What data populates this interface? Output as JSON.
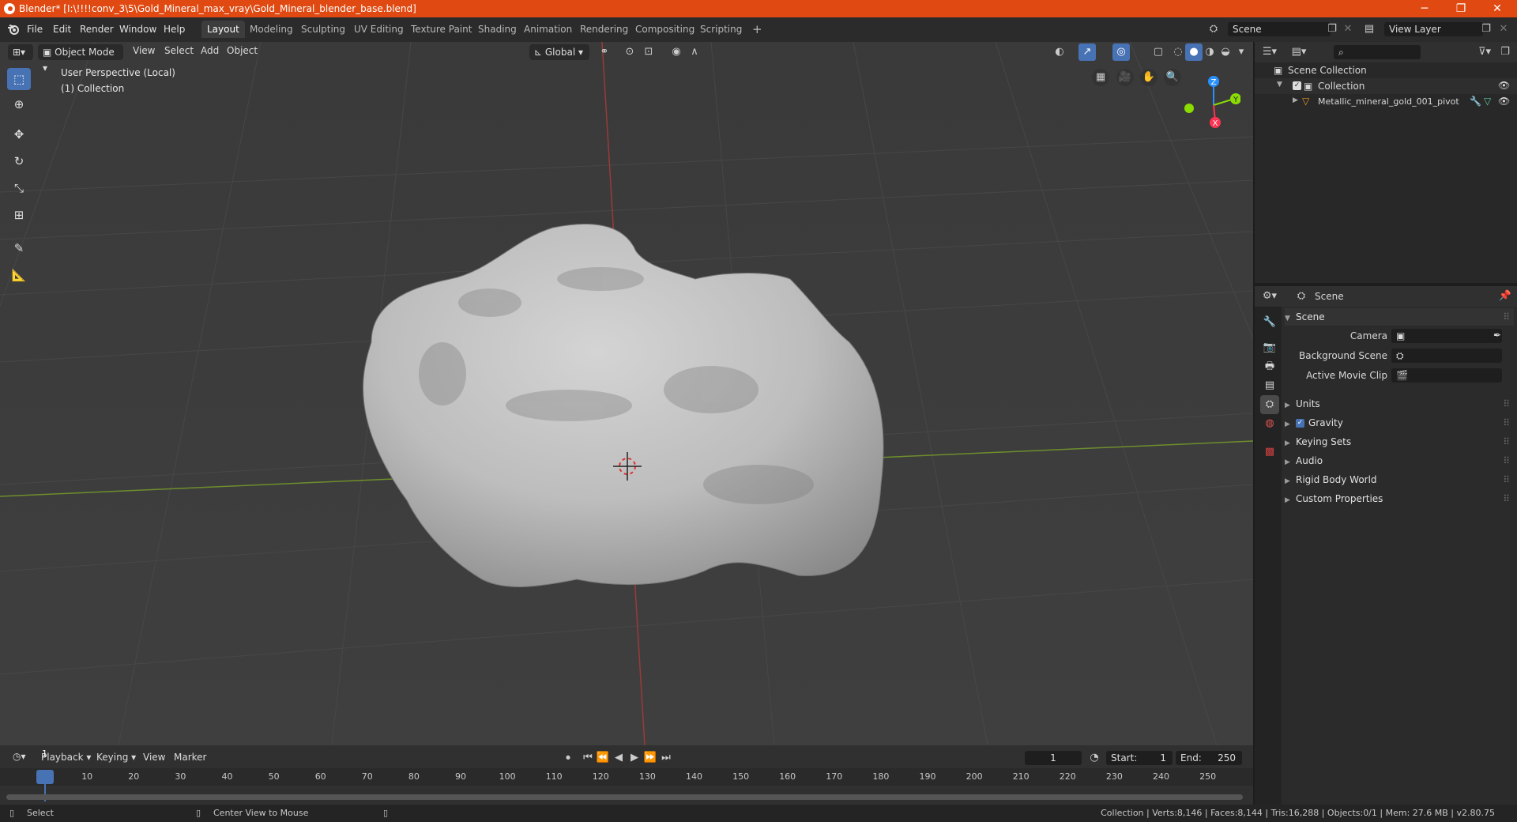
{
  "window": {
    "title": "Blender* [I:\\!!!!conv_3\\5\\Gold_Mineral_max_vray\\Gold_Mineral_blender_base.blend]",
    "minimize": "─",
    "maximize": "❐",
    "close": "✕"
  },
  "menu": [
    "File",
    "Edit",
    "Render",
    "Window",
    "Help"
  ],
  "workspaces": [
    "Layout",
    "Modeling",
    "Sculpting",
    "UV Editing",
    "Texture Paint",
    "Shading",
    "Animation",
    "Rendering",
    "Compositing",
    "Scripting"
  ],
  "add_workspace": "+",
  "scene_field": "Scene",
  "view_layer_field": "View Layer",
  "viewport": {
    "mode": "Object Mode",
    "menus": [
      "View",
      "Select",
      "Add",
      "Object"
    ],
    "orientation": "Global",
    "perspective_label": "User Perspective (Local)",
    "collection_label": "(1) Collection",
    "gizmo": {
      "z": "Z",
      "y": "Y",
      "x": "X"
    }
  },
  "outliner": {
    "root": "Scene Collection",
    "collection": "Collection",
    "object": "Metallic_mineral_gold_001_pivot"
  },
  "properties": {
    "header": "Scene",
    "panel": "Scene",
    "fields": [
      {
        "label": "Camera",
        "value": ""
      },
      {
        "label": "Background Scene",
        "value": ""
      },
      {
        "label": "Active Movie Clip",
        "value": ""
      }
    ],
    "sections": [
      "Units",
      "Gravity",
      "Keying Sets",
      "Audio",
      "Rigid Body World",
      "Custom Properties"
    ],
    "gravity_checked": true
  },
  "timeline": {
    "menus": [
      "Playback",
      "Keying",
      "View",
      "Marker"
    ],
    "current_frame": "1",
    "start_label": "Start:",
    "start": "1",
    "end_label": "End:",
    "end": "250",
    "ticks": [
      "1",
      "10",
      "20",
      "30",
      "40",
      "50",
      "60",
      "70",
      "80",
      "90",
      "100",
      "110",
      "120",
      "130",
      "140",
      "150",
      "160",
      "170",
      "180",
      "190",
      "200",
      "210",
      "220",
      "230",
      "240",
      "250"
    ]
  },
  "status": {
    "select": "Select",
    "center": "Center View to Mouse",
    "stats": "Collection | Verts:8,146 | Faces:8,144 | Tris:16,288 | Objects:0/1 | Mem: 27.6 MB | v2.80.75"
  },
  "colors": {
    "titlebar": "#e04a12",
    "accent": "#4772b3",
    "viewport_bg": "#3d3d3d",
    "x_axis": "#ff3352",
    "y_axis": "#8bdc00",
    "z_axis": "#2890ff"
  }
}
